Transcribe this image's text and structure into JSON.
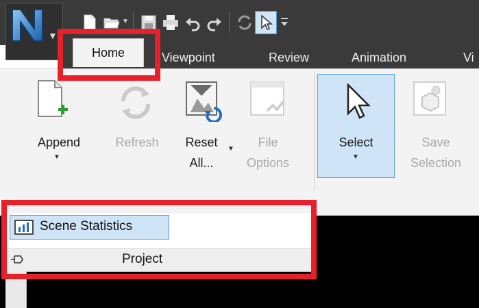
{
  "colors": {
    "title_bg": "#3a3a3a",
    "ribbon_bg": "#f3f3f3",
    "highlight_blue": "#cfe4f7",
    "accent_green": "#2aa02a",
    "annotation_red": "#e8202b"
  },
  "app_button": {
    "icon": "navisworks-n-logo-icon"
  },
  "quick_access": [
    {
      "icon": "new-file-icon"
    },
    {
      "icon": "open-folder-icon"
    },
    {
      "icon": "save-icon"
    },
    {
      "icon": "print-icon"
    },
    {
      "icon": "undo-icon"
    },
    {
      "icon": "redo-icon"
    },
    {
      "icon": "refresh-icon"
    },
    {
      "icon": "select-cursor-icon"
    },
    {
      "icon": "customize-qat-icon"
    }
  ],
  "tabs": {
    "home": "Home",
    "viewpoint": "Viewpoint",
    "review": "Review",
    "animation": "Animation",
    "view_partial": "Vi"
  },
  "ribbon": {
    "append": {
      "label": "Append",
      "icon": "append-icon"
    },
    "refresh": {
      "label": "Refresh",
      "icon": "refresh-icon"
    },
    "reset_all": {
      "label_line1": "Reset",
      "label_line2": "All...",
      "icon": "reset-all-icon"
    },
    "file_options": {
      "label_line1": "File",
      "label_line2": "Options",
      "icon": "file-options-icon"
    },
    "select": {
      "label": "Select",
      "icon": "select-cursor-icon"
    },
    "save_selection": {
      "label_line1": "Save",
      "label_line2": "Selection",
      "icon": "save-selection-icon"
    }
  },
  "project_panel": {
    "scene_statistics": "Scene Statistics",
    "panel_title": "Project"
  }
}
